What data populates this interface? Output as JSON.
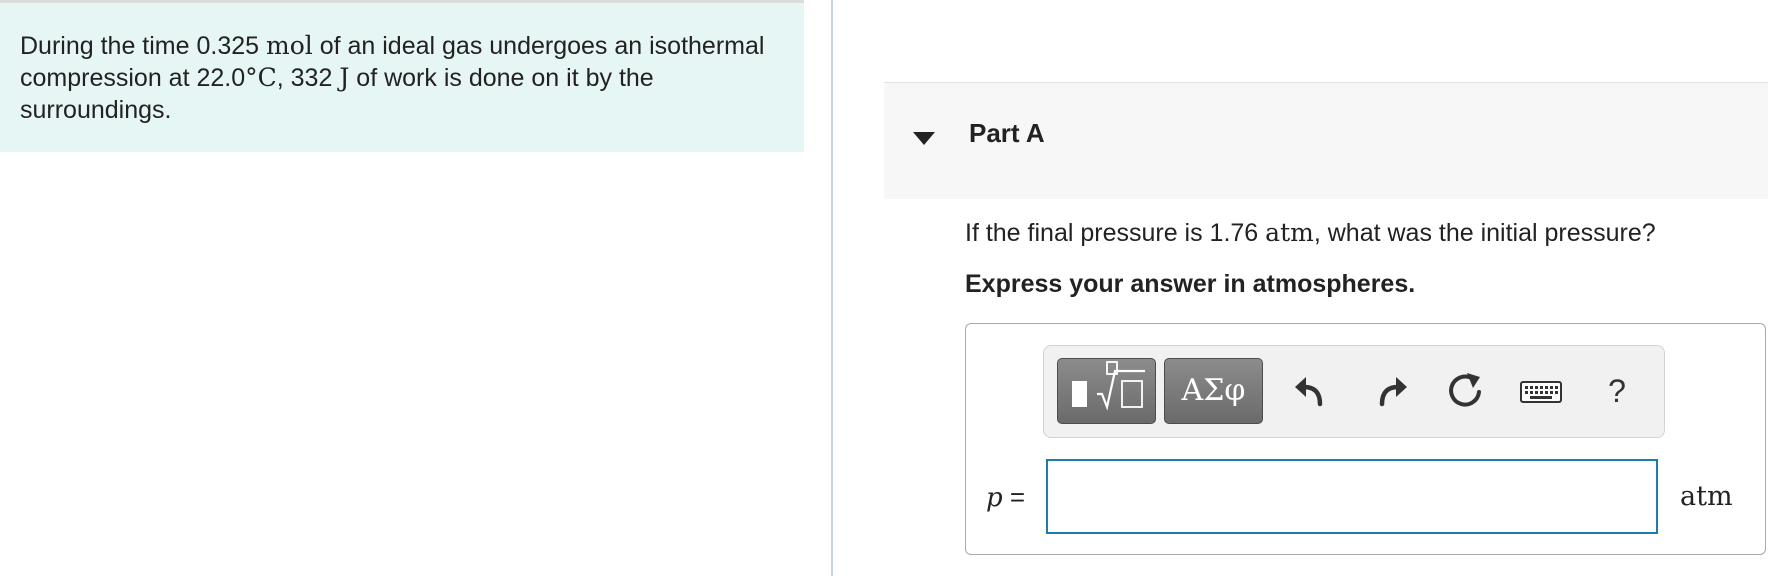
{
  "problem": {
    "t1": "During the time 0.325 ",
    "mol": "mol",
    "t2": " of an ideal gas undergoes an isothermal compression at 22.0",
    "deg": "°",
    "celsius": "C",
    "t3": ", 332 ",
    "joule": "J",
    "t4": " of work is done on it by the surroundings."
  },
  "part": {
    "title": "Part A",
    "question_pre": "If the final pressure is 1.76 ",
    "question_unit": "atm",
    "question_post": ", what was the initial pressure?",
    "instruction": "Express your answer in atmospheres."
  },
  "toolbar": {
    "templates_icon": "templates-icon",
    "symbols_label": "ΑΣφ",
    "undo_icon": "undo-icon",
    "redo_icon": "redo-icon",
    "reset_icon": "reset-icon",
    "keyboard_icon": "keyboard-icon",
    "help_label": "?"
  },
  "answer": {
    "variable": "p",
    "equals": " =",
    "value": "",
    "placeholder": "",
    "unit": "atm"
  },
  "colors": {
    "problem_bg": "#e5f6f5",
    "input_border": "#1f7ab0",
    "part_header_bg": "#f7f7f7"
  }
}
